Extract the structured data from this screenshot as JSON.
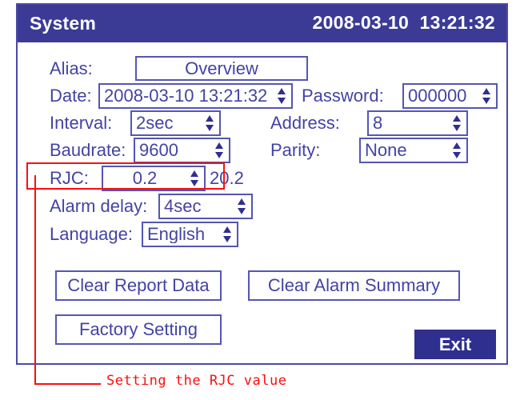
{
  "window": {
    "title": "System",
    "datetime": "2008-03-10  13:21:32"
  },
  "fields": {
    "alias": {
      "label": "Alias:",
      "value": "Overview"
    },
    "date": {
      "label": "Date:",
      "value": "2008-03-10 13:21:32"
    },
    "password": {
      "label": "Password:",
      "value": "000000"
    },
    "interval": {
      "label": "Interval:",
      "value": "2sec"
    },
    "address": {
      "label": "Address:",
      "value": "8"
    },
    "baudrate": {
      "label": "Baudrate:",
      "value": "9600"
    },
    "parity": {
      "label": "Parity:",
      "value": "None"
    },
    "rjc": {
      "label": "RJC:",
      "value": "0.2",
      "reading": "20.2"
    },
    "alarm_delay": {
      "label": "Alarm delay:",
      "value": "4sec"
    },
    "language": {
      "label": "Language:",
      "value": "English"
    }
  },
  "buttons": {
    "clear_report_data": "Clear Report Data",
    "clear_alarm_summary": "Clear Alarm Summary",
    "factory_setting": "Factory Setting",
    "exit": "Exit"
  },
  "annotation": {
    "text": "Setting the RJC value"
  },
  "colors": {
    "title_bar": "#3b3b96",
    "field_text": "#4343a6",
    "field_border": "#5555b5",
    "primary_button": "#2f2f8f",
    "annotation": "#fa0f0f"
  }
}
